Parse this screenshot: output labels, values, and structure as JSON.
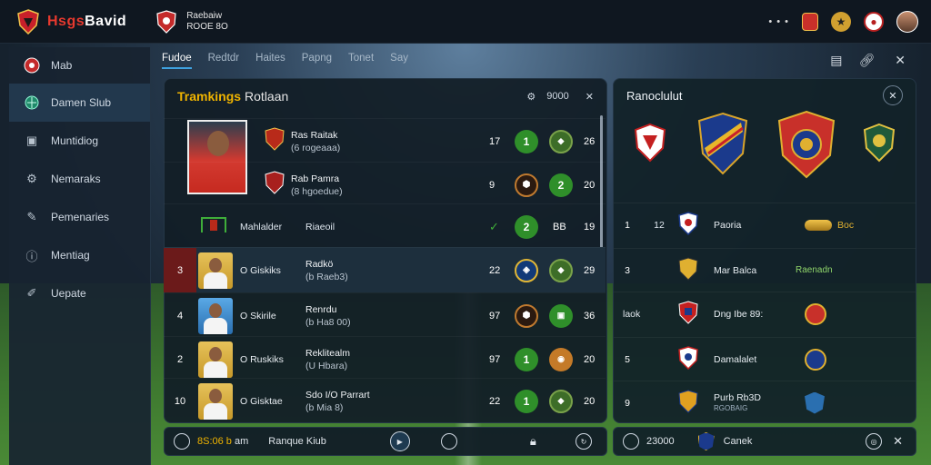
{
  "brand": {
    "name_red": "Hsgs",
    "name_white": "Bavid",
    "full": "HsggBavid"
  },
  "club": {
    "line1": "Raebaiw",
    "line2": "ROOE 8O"
  },
  "topbar": {
    "dots": "• • •"
  },
  "sidebar": {
    "items": [
      {
        "label": "Mab",
        "icon": "club-crest-icon"
      },
      {
        "label": "Damen Slub",
        "icon": "globe-icon"
      },
      {
        "label": "Muntidiog",
        "icon": "grid-icon"
      },
      {
        "label": "Nemaraks",
        "icon": "gear-icon"
      },
      {
        "label": "Pemenaries",
        "icon": "pen-icon"
      },
      {
        "label": "Mentiag",
        "icon": "info-icon"
      },
      {
        "label": "Uepate",
        "icon": "edit-icon"
      }
    ]
  },
  "tabs": [
    "Fudoe",
    "Redtdr",
    "Haites",
    "Papng",
    "Tonet",
    "Say"
  ],
  "main": {
    "title": "Tramkings",
    "title_sub": "Rotlaan",
    "header_value": "9000",
    "rows": [
      {
        "rank": "",
        "name": "",
        "line1": "Ras Raitak",
        "line2": "(6 rogeaaa)",
        "a": "17",
        "b_top": "1",
        "c_top": "26"
      },
      {
        "rank": "",
        "name": "",
        "line1": "Rab Pamra",
        "line2": "(8 hgoedue)",
        "a": "9",
        "b_top": "2",
        "c_top": "20"
      },
      {
        "rank": "",
        "name": "Mahlalder",
        "line1": "Riaeoil",
        "line2": "",
        "a": "",
        "b_top": "2",
        "c_top": "19",
        "badge": "BB"
      },
      {
        "rank": "3",
        "name": "O Giskiks",
        "line1": "Radkö",
        "line2": "(b Raeb3)",
        "a": "22",
        "b_top": "",
        "c_top": "29"
      },
      {
        "rank": "4",
        "name": "O Skirile",
        "line1": "Renrdu",
        "line2": "(b Ha8 00)",
        "a": "97",
        "b_top": "",
        "c_top": "36"
      },
      {
        "rank": "2",
        "name": "O Ruskiks",
        "line1": "Reklitealm",
        "line2": "(U Hbara)",
        "a": "97",
        "b_top": "1",
        "c_top": "20"
      },
      {
        "rank": "10",
        "name": "O Gisktae",
        "line1": "Sdo I/O Parrart",
        "line2": "(b Mia 8)",
        "a": "22",
        "b_top": "1",
        "c_top": "20"
      }
    ]
  },
  "main_footer": {
    "value": "8S:06 b",
    "unit": "am",
    "label": "Ranque Kiub"
  },
  "side": {
    "title": "Ranoclulut",
    "rows": [
      {
        "rank": "1",
        "pos": "12",
        "name": "Paoria",
        "val": "Boc"
      },
      {
        "rank": "3",
        "pos": "",
        "name": "Mar Balca",
        "val": "Raenadn"
      },
      {
        "rank": "",
        "pos": "laok",
        "name": "Dng Ibe 89:",
        "val": ""
      },
      {
        "rank": "5",
        "pos": "",
        "name": "Damalalet",
        "val": ""
      },
      {
        "rank": "9",
        "pos": "",
        "name": "Purb Rb3D",
        "val": ""
      }
    ],
    "row_sub": "RGOBAIG",
    "footer_value": "23000",
    "footer_label": "Canek"
  },
  "colors": {
    "accent": "#f0b400",
    "brand_red": "#e7392e",
    "green": "#2f8f2a"
  }
}
